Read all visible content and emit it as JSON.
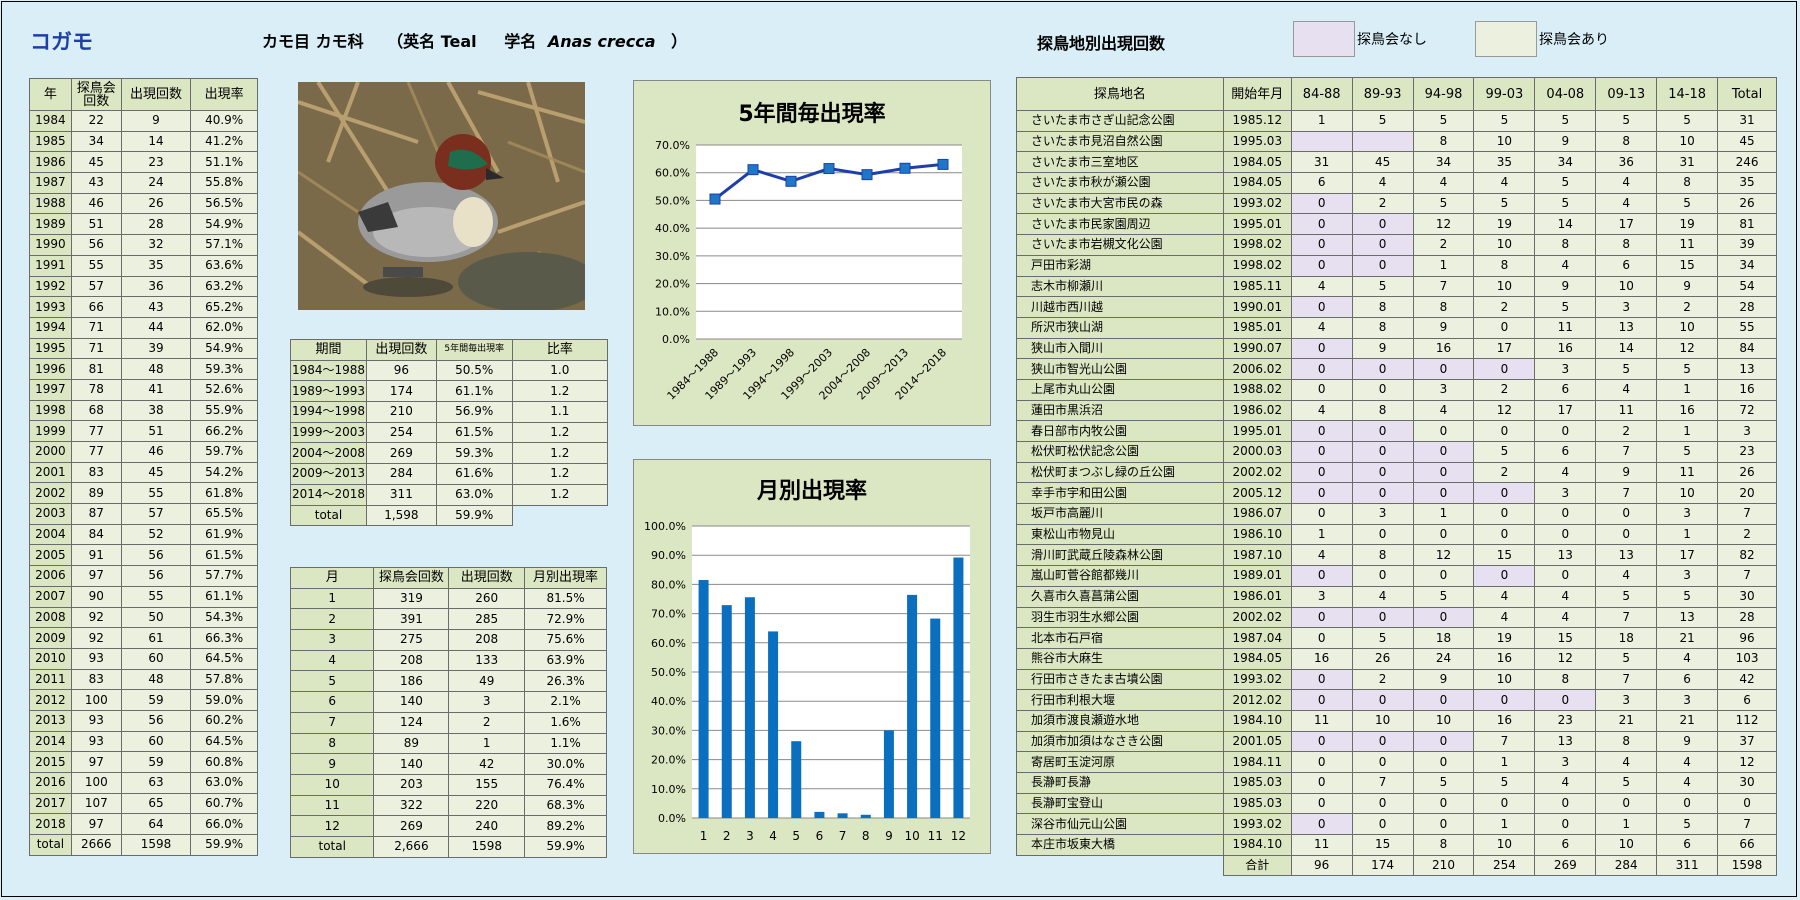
{
  "title": "コガモ",
  "header": {
    "order_family": "カモ目 カモ科",
    "en_prefix": "（英名 Teal",
    "sci_prefix": "学名",
    "sci_name": "Anas crecca",
    "close": "）"
  },
  "site_section_title": "探鳥地別出現回数",
  "legend": {
    "none": "探鳥会なし",
    "exists": "探鳥会あり",
    "none_color": "#e6e0f0",
    "exists_color": "#ebf1de"
  },
  "yearly": {
    "headers": [
      "年",
      "探鳥会\n回数",
      "出現回数",
      "出現率"
    ],
    "rows": [
      [
        "1984",
        "22",
        "9",
        "40.9%"
      ],
      [
        "1985",
        "34",
        "14",
        "41.2%"
      ],
      [
        "1986",
        "45",
        "23",
        "51.1%"
      ],
      [
        "1987",
        "43",
        "24",
        "55.8%"
      ],
      [
        "1988",
        "46",
        "26",
        "56.5%"
      ],
      [
        "1989",
        "51",
        "28",
        "54.9%"
      ],
      [
        "1990",
        "56",
        "32",
        "57.1%"
      ],
      [
        "1991",
        "55",
        "35",
        "63.6%"
      ],
      [
        "1992",
        "57",
        "36",
        "63.2%"
      ],
      [
        "1993",
        "66",
        "43",
        "65.2%"
      ],
      [
        "1994",
        "71",
        "44",
        "62.0%"
      ],
      [
        "1995",
        "71",
        "39",
        "54.9%"
      ],
      [
        "1996",
        "81",
        "48",
        "59.3%"
      ],
      [
        "1997",
        "78",
        "41",
        "52.6%"
      ],
      [
        "1998",
        "68",
        "38",
        "55.9%"
      ],
      [
        "1999",
        "77",
        "51",
        "66.2%"
      ],
      [
        "2000",
        "77",
        "46",
        "59.7%"
      ],
      [
        "2001",
        "83",
        "45",
        "54.2%"
      ],
      [
        "2002",
        "89",
        "55",
        "61.8%"
      ],
      [
        "2003",
        "87",
        "57",
        "65.5%"
      ],
      [
        "2004",
        "84",
        "52",
        "61.9%"
      ],
      [
        "2005",
        "91",
        "56",
        "61.5%"
      ],
      [
        "2006",
        "97",
        "56",
        "57.7%"
      ],
      [
        "2007",
        "90",
        "55",
        "61.1%"
      ],
      [
        "2008",
        "92",
        "50",
        "54.3%"
      ],
      [
        "2009",
        "92",
        "61",
        "66.3%"
      ],
      [
        "2010",
        "93",
        "60",
        "64.5%"
      ],
      [
        "2011",
        "83",
        "48",
        "57.8%"
      ],
      [
        "2012",
        "100",
        "59",
        "59.0%"
      ],
      [
        "2013",
        "93",
        "56",
        "60.2%"
      ],
      [
        "2014",
        "93",
        "60",
        "64.5%"
      ],
      [
        "2015",
        "97",
        "59",
        "60.8%"
      ],
      [
        "2016",
        "100",
        "63",
        "63.0%"
      ],
      [
        "2017",
        "107",
        "65",
        "60.7%"
      ],
      [
        "2018",
        "97",
        "64",
        "66.0%"
      ],
      [
        "total",
        "2666",
        "1598",
        "59.9%"
      ]
    ]
  },
  "period": {
    "headers": [
      "期間",
      "出現回数",
      "5年間毎出現率",
      "比率"
    ],
    "rows": [
      [
        "1984～1988",
        "96",
        "50.5%",
        "1.0"
      ],
      [
        "1989～1993",
        "174",
        "61.1%",
        "1.2"
      ],
      [
        "1994～1998",
        "210",
        "56.9%",
        "1.1"
      ],
      [
        "1999～2003",
        "254",
        "61.5%",
        "1.2"
      ],
      [
        "2004～2008",
        "269",
        "59.3%",
        "1.2"
      ],
      [
        "2009～2013",
        "284",
        "61.6%",
        "1.2"
      ],
      [
        "2014～2018",
        "311",
        "63.0%",
        "1.2"
      ]
    ],
    "total": [
      "total",
      "1,598",
      "59.9%"
    ]
  },
  "monthly": {
    "headers": [
      "月",
      "探鳥会回数",
      "出現回数",
      "月別出現率"
    ],
    "rows": [
      [
        "1",
        "319",
        "260",
        "81.5%"
      ],
      [
        "2",
        "391",
        "285",
        "72.9%"
      ],
      [
        "3",
        "275",
        "208",
        "75.6%"
      ],
      [
        "4",
        "208",
        "133",
        "63.9%"
      ],
      [
        "5",
        "186",
        "49",
        "26.3%"
      ],
      [
        "6",
        "140",
        "3",
        "2.1%"
      ],
      [
        "7",
        "124",
        "2",
        "1.6%"
      ],
      [
        "8",
        "89",
        "1",
        "1.1%"
      ],
      [
        "9",
        "140",
        "42",
        "30.0%"
      ],
      [
        "10",
        "203",
        "155",
        "76.4%"
      ],
      [
        "11",
        "322",
        "220",
        "68.3%"
      ],
      [
        "12",
        "269",
        "240",
        "89.2%"
      ],
      [
        "total",
        "2,666",
        "1598",
        "59.9%"
      ]
    ]
  },
  "sites": {
    "headers": [
      "探鳥地名",
      "開始年月",
      "84-88",
      "89-93",
      "94-98",
      "99-03",
      "04-08",
      "09-13",
      "14-18",
      "Total"
    ],
    "rows": [
      {
        "c": [
          "さいたま市さぎ山記念公園",
          "1985.12",
          "1",
          "5",
          "5",
          "5",
          "5",
          "5",
          "5",
          "31"
        ],
        "n": []
      },
      {
        "c": [
          "さいたま市見沼自然公園",
          "1995.03",
          "",
          "",
          "8",
          "10",
          "9",
          "8",
          "10",
          "45"
        ],
        "n": [
          0,
          1
        ]
      },
      {
        "c": [
          "さいたま市三室地区",
          "1984.05",
          "31",
          "45",
          "34",
          "35",
          "34",
          "36",
          "31",
          "246"
        ],
        "n": []
      },
      {
        "c": [
          "さいたま市秋が瀬公園",
          "1984.05",
          "6",
          "4",
          "4",
          "4",
          "5",
          "4",
          "8",
          "35"
        ],
        "n": []
      },
      {
        "c": [
          "さいたま市大宮市民の森",
          "1993.02",
          "0",
          "2",
          "5",
          "5",
          "5",
          "4",
          "5",
          "26"
        ],
        "n": [
          0
        ]
      },
      {
        "c": [
          "さいたま市民家園周辺",
          "1995.01",
          "0",
          "0",
          "12",
          "19",
          "14",
          "17",
          "19",
          "81"
        ],
        "n": [
          0,
          1
        ]
      },
      {
        "c": [
          "さいたま市岩槻文化公園",
          "1998.02",
          "0",
          "0",
          "2",
          "10",
          "8",
          "8",
          "11",
          "39"
        ],
        "n": [
          0,
          1
        ]
      },
      {
        "c": [
          "戸田市彩湖",
          "1998.02",
          "0",
          "0",
          "1",
          "8",
          "4",
          "6",
          "15",
          "34"
        ],
        "n": [
          0,
          1
        ]
      },
      {
        "c": [
          "志木市柳瀬川",
          "1985.11",
          "4",
          "5",
          "7",
          "10",
          "9",
          "10",
          "9",
          "54"
        ],
        "n": []
      },
      {
        "c": [
          "川越市西川越",
          "1990.01",
          "0",
          "8",
          "8",
          "2",
          "5",
          "3",
          "2",
          "28"
        ],
        "n": [
          0
        ]
      },
      {
        "c": [
          "所沢市狭山湖",
          "1985.01",
          "4",
          "8",
          "9",
          "0",
          "11",
          "13",
          "10",
          "55"
        ],
        "n": []
      },
      {
        "c": [
          "狭山市入間川",
          "1990.07",
          "0",
          "9",
          "16",
          "17",
          "16",
          "14",
          "12",
          "84"
        ],
        "n": [
          0
        ]
      },
      {
        "c": [
          "狭山市智光山公園",
          "2006.02",
          "0",
          "0",
          "0",
          "0",
          "3",
          "5",
          "5",
          "13"
        ],
        "n": [
          0,
          1,
          2,
          3
        ]
      },
      {
        "c": [
          "上尾市丸山公園",
          "1988.02",
          "0",
          "0",
          "3",
          "2",
          "6",
          "4",
          "1",
          "16"
        ],
        "n": []
      },
      {
        "c": [
          "蓮田市黒浜沼",
          "1986.02",
          "4",
          "8",
          "4",
          "12",
          "17",
          "11",
          "16",
          "72"
        ],
        "n": []
      },
      {
        "c": [
          "春日部市内牧公園",
          "1995.01",
          "0",
          "0",
          "0",
          "0",
          "0",
          "2",
          "1",
          "3"
        ],
        "n": [
          0,
          1
        ]
      },
      {
        "c": [
          "松伏町松伏記念公園",
          "2000.03",
          "0",
          "0",
          "0",
          "5",
          "6",
          "7",
          "5",
          "23"
        ],
        "n": [
          0,
          1,
          2
        ]
      },
      {
        "c": [
          "松伏町まつぶし緑の丘公園",
          "2002.02",
          "0",
          "0",
          "0",
          "2",
          "4",
          "9",
          "11",
          "26"
        ],
        "n": [
          0,
          1,
          2
        ]
      },
      {
        "c": [
          "幸手市宇和田公園",
          "2005.12",
          "0",
          "0",
          "0",
          "0",
          "3",
          "7",
          "10",
          "20"
        ],
        "n": [
          0,
          1,
          2,
          3
        ]
      },
      {
        "c": [
          "坂戸市高麗川",
          "1986.07",
          "0",
          "3",
          "1",
          "0",
          "0",
          "0",
          "3",
          "7"
        ],
        "n": []
      },
      {
        "c": [
          "東松山市物見山",
          "1986.10",
          "1",
          "0",
          "0",
          "0",
          "0",
          "0",
          "1",
          "2"
        ],
        "n": []
      },
      {
        "c": [
          "滑川町武蔵丘陵森林公園",
          "1987.10",
          "4",
          "8",
          "12",
          "15",
          "13",
          "13",
          "17",
          "82"
        ],
        "n": []
      },
      {
        "c": [
          "嵐山町菅谷館都幾川",
          "1989.01",
          "0",
          "0",
          "0",
          "0",
          "0",
          "4",
          "3",
          "7"
        ],
        "n": [
          0,
          3
        ]
      },
      {
        "c": [
          "久喜市久喜菖蒲公園",
          "1986.01",
          "3",
          "4",
          "5",
          "4",
          "4",
          "5",
          "5",
          "30"
        ],
        "n": []
      },
      {
        "c": [
          "羽生市羽生水郷公園",
          "2002.02",
          "0",
          "0",
          "0",
          "4",
          "4",
          "7",
          "13",
          "28"
        ],
        "n": [
          0,
          1,
          2
        ]
      },
      {
        "c": [
          "北本市石戸宿",
          "1987.04",
          "0",
          "5",
          "18",
          "19",
          "15",
          "18",
          "21",
          "96"
        ],
        "n": []
      },
      {
        "c": [
          "熊谷市大麻生",
          "1984.05",
          "16",
          "26",
          "24",
          "16",
          "12",
          "5",
          "4",
          "103"
        ],
        "n": []
      },
      {
        "c": [
          "行田市さきたま古墳公園",
          "1993.02",
          "0",
          "2",
          "9",
          "10",
          "8",
          "7",
          "6",
          "42"
        ],
        "n": [
          0
        ]
      },
      {
        "c": [
          "行田市利根大堰",
          "2012.02",
          "0",
          "0",
          "0",
          "0",
          "0",
          "3",
          "3",
          "6"
        ],
        "n": [
          0,
          1,
          2,
          3,
          4
        ]
      },
      {
        "c": [
          "加須市渡良瀬遊水地",
          "1984.10",
          "11",
          "10",
          "10",
          "16",
          "23",
          "21",
          "21",
          "112"
        ],
        "n": []
      },
      {
        "c": [
          "加須市加須はなさき公園",
          "2001.05",
          "0",
          "0",
          "0",
          "7",
          "13",
          "8",
          "9",
          "37"
        ],
        "n": [
          0,
          1,
          2
        ]
      },
      {
        "c": [
          "寄居町玉淀河原",
          "1984.11",
          "0",
          "0",
          "0",
          "1",
          "3",
          "4",
          "4",
          "12"
        ],
        "n": []
      },
      {
        "c": [
          "長瀞町長瀞",
          "1985.03",
          "0",
          "7",
          "5",
          "5",
          "4",
          "5",
          "4",
          "30"
        ],
        "n": []
      },
      {
        "c": [
          "長瀞町宝登山",
          "1985.03",
          "0",
          "0",
          "0",
          "0",
          "0",
          "0",
          "0",
          "0"
        ],
        "n": []
      },
      {
        "c": [
          "深谷市仙元山公園",
          "1993.02",
          "0",
          "0",
          "0",
          "1",
          "0",
          "1",
          "5",
          "7"
        ],
        "n": [
          0
        ]
      },
      {
        "c": [
          "本庄市坂東大橋",
          "1984.10",
          "11",
          "15",
          "8",
          "10",
          "6",
          "10",
          "6",
          "66"
        ],
        "n": []
      }
    ],
    "total": [
      "合計",
      "96",
      "174",
      "210",
      "254",
      "269",
      "284",
      "311",
      "1598"
    ]
  },
  "chart_data": [
    {
      "type": "line",
      "title": "5年間毎出現率",
      "categories": [
        "1984～1988",
        "1989～1993",
        "1994～1998",
        "1999～2003",
        "2004～2008",
        "2009～2013",
        "2014～2018"
      ],
      "values": [
        50.5,
        61.1,
        56.9,
        61.5,
        59.3,
        61.6,
        63.0
      ],
      "ylim": [
        0,
        70
      ],
      "yticks": [
        "0.0%",
        "10.0%",
        "20.0%",
        "30.0%",
        "40.0%",
        "50.0%",
        "60.0%",
        "70.0%"
      ],
      "grid": true,
      "color": "#1f3fa8"
    },
    {
      "type": "bar",
      "title": "月別出現率",
      "categories": [
        "1",
        "2",
        "3",
        "4",
        "5",
        "6",
        "7",
        "8",
        "9",
        "10",
        "11",
        "12"
      ],
      "values": [
        81.5,
        72.9,
        75.6,
        63.9,
        26.3,
        2.1,
        1.6,
        1.1,
        30.0,
        76.4,
        68.3,
        89.2
      ],
      "ylim": [
        0,
        100
      ],
      "yticks": [
        "0.0%",
        "10.0%",
        "20.0%",
        "30.0%",
        "40.0%",
        "50.0%",
        "60.0%",
        "70.0%",
        "80.0%",
        "90.0%",
        "100.0%"
      ],
      "grid": true,
      "color": "#0a6fbf"
    }
  ]
}
